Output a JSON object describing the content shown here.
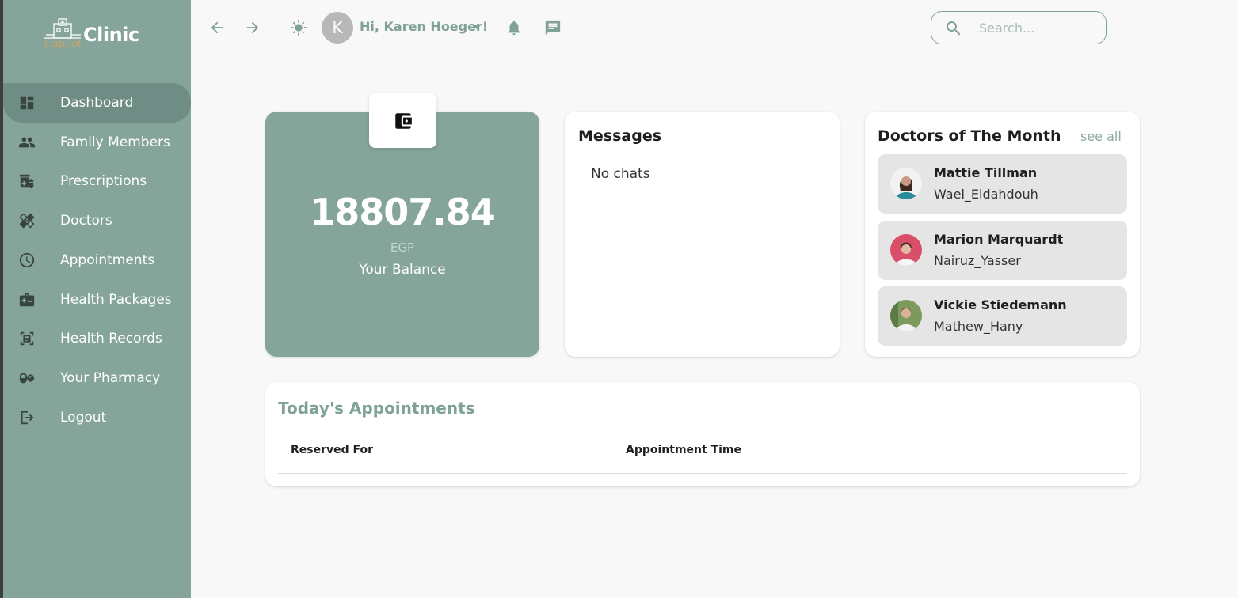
{
  "brand": {
    "name": "Clinic",
    "subtitle": "Copilot"
  },
  "sidebar": {
    "items": [
      {
        "label": "Dashboard",
        "icon": "dashboard-icon",
        "active": true
      },
      {
        "label": "Family Members",
        "icon": "people-icon"
      },
      {
        "label": "Prescriptions",
        "icon": "prescription-icon"
      },
      {
        "label": "Doctors",
        "icon": "bandage-icon"
      },
      {
        "label": "Appointments",
        "icon": "clock-icon"
      },
      {
        "label": "Health Packages",
        "icon": "medical-kit-icon"
      },
      {
        "label": "Health Records",
        "icon": "records-icon"
      },
      {
        "label": "Your Pharmacy",
        "icon": "pills-icon"
      },
      {
        "label": "Logout",
        "icon": "logout-icon"
      }
    ]
  },
  "topbar": {
    "avatar_letter": "K",
    "greeting": "Hi, Karen Hoeger!",
    "search_placeholder": "Search..."
  },
  "balance": {
    "amount": "18807.84",
    "currency": "EGP",
    "label": "Your Balance"
  },
  "messages": {
    "title": "Messages",
    "empty_text": "No chats"
  },
  "doctors": {
    "title": "Doctors of The Month",
    "see_all": "see all",
    "list": [
      {
        "name": "Mattie Tillman",
        "username": "Wael_Eldahdouh"
      },
      {
        "name": "Marion Marquardt",
        "username": "Nairuz_Yasser"
      },
      {
        "name": "Vickie Stiedemann",
        "username": "Mathew_Hany"
      }
    ]
  },
  "appointments": {
    "title": "Today's Appointments",
    "columns": [
      "Reserved For",
      "Appointment Time"
    ]
  },
  "colors": {
    "primary": "#85a59b",
    "accent": "#7fa196",
    "sidebar_active": "#6f8d84"
  }
}
